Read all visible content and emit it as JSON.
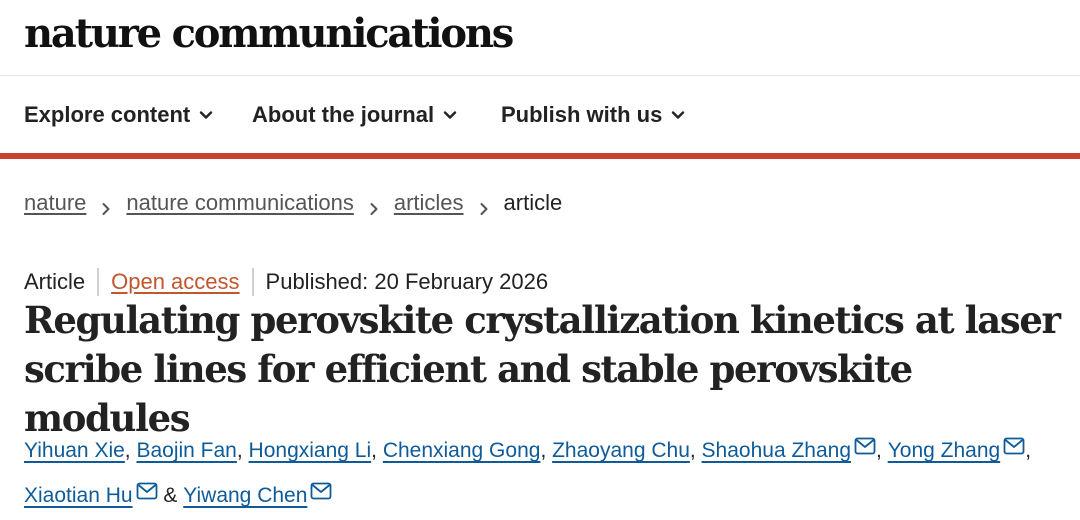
{
  "masthead": {
    "logo_text": "nature communications"
  },
  "nav": {
    "items": [
      {
        "label": "Explore content"
      },
      {
        "label": "About the journal"
      },
      {
        "label": "Publish with us"
      }
    ],
    "chevron_icon": "chevron-down-icon"
  },
  "colors": {
    "accent_bar": "#c9412e",
    "author_link": "#0f5b99",
    "open_access": "#c0572e"
  },
  "breadcrumb": {
    "items": [
      {
        "label": "nature"
      },
      {
        "label": "nature communications"
      },
      {
        "label": "articles"
      }
    ],
    "current": "article",
    "separator_icon": "chevron-right-icon"
  },
  "article": {
    "type": "Article",
    "open_access": "Open access",
    "published": "Published: 20 February 2026",
    "title": "Regulating perovskite crystallization kinetics at laser scribe lines for efficient and stable perovskite modules",
    "authors": [
      {
        "name": "Yihuan Xie"
      },
      {
        "name": "Baojin Fan"
      },
      {
        "name": "Hongxiang Li"
      },
      {
        "name": "Chenxiang Gong"
      },
      {
        "name": "Zhaoyang Chu"
      },
      {
        "name": "Shaohua Zhang"
      },
      {
        "name": "Yong Zhang"
      },
      {
        "name": "Xiaotian Hu"
      },
      {
        "name": "Yiwang Chen"
      }
    ],
    "author_separator": ", ",
    "last_separator": " & ",
    "mail_icon": "envelope-icon"
  }
}
